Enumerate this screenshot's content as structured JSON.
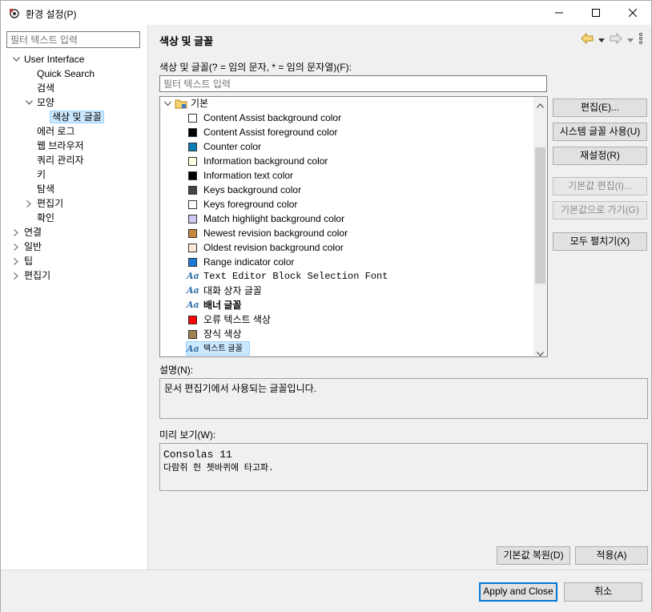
{
  "window": {
    "title": "환경 설정(P)"
  },
  "left": {
    "filter_placeholder": "필터 텍스트 입력",
    "tree": [
      {
        "label": "User Interface",
        "arrow": "expanded"
      },
      {
        "label": "Quick Search"
      },
      {
        "label": "검색"
      },
      {
        "label": "모양",
        "arrow": "expanded"
      },
      {
        "label": "색상 및 글꼴",
        "selected": true
      },
      {
        "label": "에러 로그"
      },
      {
        "label": "웹 브라우저"
      },
      {
        "label": "쿼리 관리자"
      },
      {
        "label": "키"
      },
      {
        "label": "탐색"
      },
      {
        "label": "편집기",
        "arrow": "collapsed"
      },
      {
        "label": "확인"
      },
      {
        "label": "연결",
        "arrow": "collapsed"
      },
      {
        "label": "일반",
        "arrow": "collapsed"
      },
      {
        "label": "팁",
        "arrow": "collapsed"
      },
      {
        "label": "편집기",
        "arrow": "collapsed"
      }
    ]
  },
  "right": {
    "title": "색상 및 글꼴",
    "list_label": "색상 및 글꼴(? = 임의 문자, * = 임의 문자열)(F):",
    "filter_placeholder": "필터 텍스트 입력",
    "group_label": "기본",
    "items": [
      {
        "type": "color",
        "label": "Content Assist background color",
        "color": "#ffffff"
      },
      {
        "type": "color",
        "label": "Content Assist foreground color",
        "color": "#000000"
      },
      {
        "type": "color",
        "label": "Counter color",
        "color": "#0a7eb4"
      },
      {
        "type": "color",
        "label": "Information background color",
        "color": "#ffffe1"
      },
      {
        "type": "color",
        "label": "Information text color",
        "color": "#000000"
      },
      {
        "type": "color",
        "label": "Keys background color",
        "color": "#454545"
      },
      {
        "type": "color",
        "label": "Keys foreground color",
        "color": "#ffffff"
      },
      {
        "type": "color",
        "label": "Match highlight background color",
        "color": "#d0c8f0"
      },
      {
        "type": "color",
        "label": "Newest revision background color",
        "color": "#c8883c"
      },
      {
        "type": "color",
        "label": "Oldest revision background color",
        "color": "#fde8dc"
      },
      {
        "type": "color",
        "label": "Range indicator color",
        "color": "#1a7ad6"
      },
      {
        "type": "font",
        "label": "Text Editor Block Selection Font",
        "style": "mono"
      },
      {
        "type": "font",
        "label": "대화 상자 글꼴",
        "style": "normal"
      },
      {
        "type": "font",
        "label": "배너 글꼴",
        "style": "bold"
      },
      {
        "type": "color",
        "label": "오류 텍스트 색상",
        "color": "#ff0000"
      },
      {
        "type": "color",
        "label": "장식 색상",
        "color": "#a08050"
      },
      {
        "type": "font",
        "label": "텍스트 글꼴",
        "style": "small",
        "selected": true
      }
    ],
    "buttons": {
      "edit": "편집(E)...",
      "use_system_font": "시스템 글꼴 사용(U)",
      "reset": "재설정(R)",
      "edit_default": "기본값 편집(I)...",
      "goto_default": "기본값으로 가기(G)",
      "expand_all": "모두 펼치기(X)"
    },
    "description_label": "설명(N):",
    "description_text": "문서 편집기에서 사용되는 글꼴입니다.",
    "preview_label": "미리 보기(W):",
    "preview_font": "Consolas 11",
    "preview_sample": "다람쥐 헌 쳇바퀴에 타고파.",
    "restore_defaults": "기본값 복원(D)",
    "apply": "적용(A)"
  },
  "footer": {
    "apply_close": "Apply and Close",
    "cancel": "취소"
  }
}
